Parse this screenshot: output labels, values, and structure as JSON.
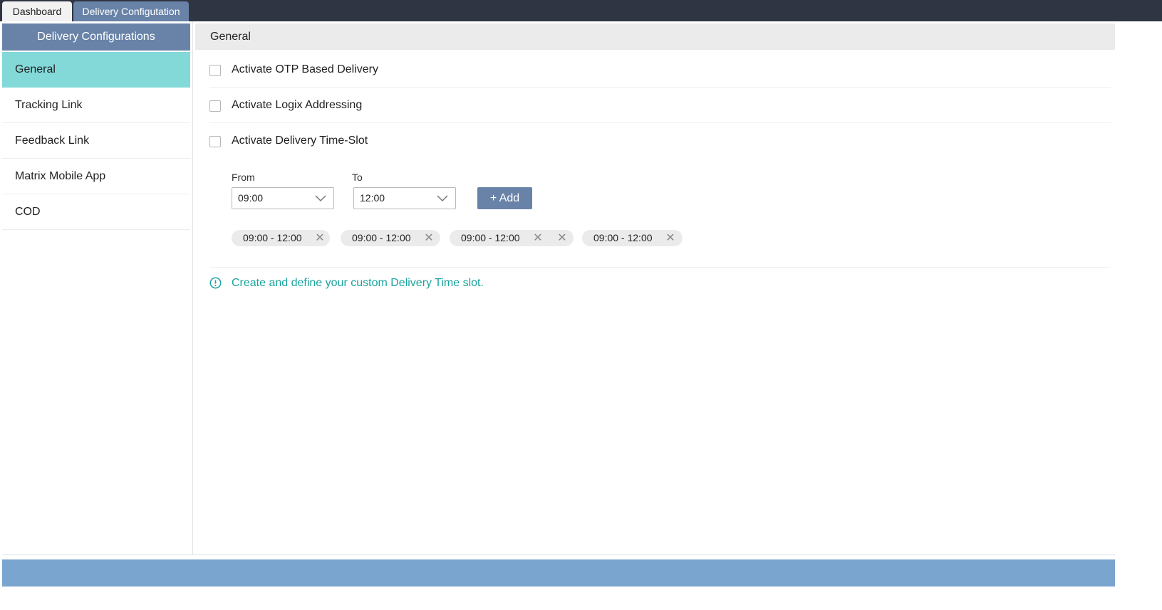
{
  "tabs": [
    {
      "label": "Dashboard",
      "active": false
    },
    {
      "label": "Delivery Configutation",
      "active": true
    }
  ],
  "sidebar": {
    "title": "Delivery Configurations",
    "items": [
      {
        "label": "General",
        "active": true
      },
      {
        "label": "Tracking Link",
        "active": false
      },
      {
        "label": "Feedback Link",
        "active": false
      },
      {
        "label": "Matrix Mobile App",
        "active": false
      },
      {
        "label": "COD",
        "active": false
      }
    ]
  },
  "main": {
    "title": "General",
    "options": [
      {
        "label": "Activate OTP Based Delivery",
        "checked": false
      },
      {
        "label": "Activate Logix Addressing",
        "checked": false
      },
      {
        "label": "Activate Delivery Time-Slot",
        "checked": false
      }
    ],
    "time_slot": {
      "from_label": "From",
      "from_value": "09:00",
      "to_label": "To",
      "to_value": "12:00",
      "add_label": "+ Add",
      "chips": [
        "09:00 - 12:00",
        "09:00 - 12:00",
        "09:00 - 12:00",
        "09:00 - 12:00"
      ]
    },
    "info_text": "Create and define your custom Delivery Time slot."
  },
  "colors": {
    "topbar": "#2f3542",
    "accent": "#6983a8",
    "active_nav": "#83d8d8",
    "info": "#1aa39e",
    "footer": "#7aa5cf"
  },
  "icons": {
    "dropdown": "chevron-down-icon",
    "remove": "close-icon",
    "info": "info-icon"
  }
}
